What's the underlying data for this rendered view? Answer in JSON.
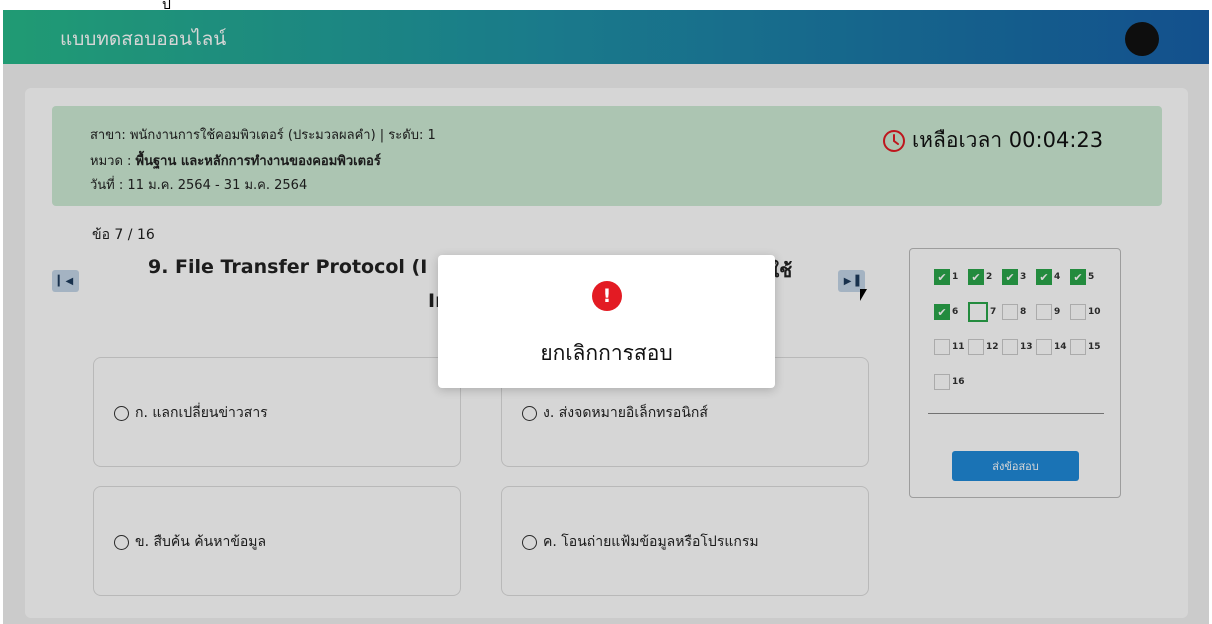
{
  "header": {
    "title": "แบบทดสอบออนไลน์",
    "stray_mark": "ป"
  },
  "info": {
    "branch_label": "สาขา:",
    "branch": "พนักงานการใช้คอมพิวเตอร์ (ประมวลผลคำ) | ระดับ: 1",
    "category_label": "หมวด :",
    "category": "พื้นฐาน และหลักการทำงานของคอมพิวเตอร์",
    "date_label": "วันที่ :",
    "date": "11 ม.ค. 2564 - 31 ม.ค. 2564",
    "timer": "เหลือเวลา 00:04:23"
  },
  "question": {
    "counter": "ข้อ 7 / 16",
    "text_visible": "9. File Transfer Protocol (I",
    "text_tail": "ใช้",
    "text_line2": "In",
    "options": [
      {
        "label": "ก. แลกเปลี่ยนข่าวสาร"
      },
      {
        "label": "ง. ส่งจดหมายอิเล็กทรอนิกส์"
      },
      {
        "label": "ข. สืบค้น ค้นหาข้อมูล"
      },
      {
        "label": "ค. โอนถ่ายแฟ้มข้อมูลหรือโปรแกรม"
      }
    ]
  },
  "nav": {
    "first_icon": "skip-first-icon",
    "last_icon": "skip-last-icon"
  },
  "panel": {
    "items": [
      {
        "n": "1",
        "state": "done"
      },
      {
        "n": "2",
        "state": "done"
      },
      {
        "n": "3",
        "state": "done"
      },
      {
        "n": "4",
        "state": "done"
      },
      {
        "n": "5",
        "state": "done"
      },
      {
        "n": "6",
        "state": "done"
      },
      {
        "n": "7",
        "state": "current"
      },
      {
        "n": "8",
        "state": "empty"
      },
      {
        "n": "9",
        "state": "empty"
      },
      {
        "n": "10",
        "state": "empty"
      },
      {
        "n": "11",
        "state": "empty"
      },
      {
        "n": "12",
        "state": "empty"
      },
      {
        "n": "13",
        "state": "empty"
      },
      {
        "n": "14",
        "state": "empty"
      },
      {
        "n": "15",
        "state": "empty"
      },
      {
        "n": "16",
        "state": "empty"
      }
    ],
    "submit_label": "ส่งข้อสอบ"
  },
  "modal": {
    "icon": "exclamation-icon",
    "icon_glyph": "!",
    "message": "ยกเลิกการสอบ"
  },
  "colors": {
    "accent_green": "#2aa64b",
    "submit_blue": "#1f8ad8",
    "alert_red": "#e31b23",
    "info_bg": "#cdebd5"
  }
}
